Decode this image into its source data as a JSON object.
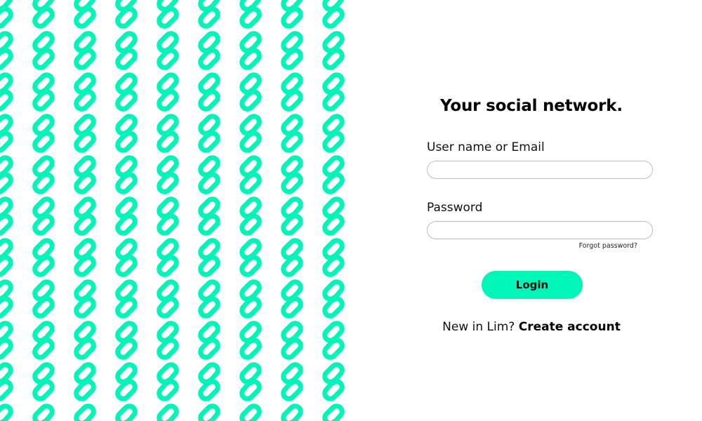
{
  "brand": {
    "accent_color": "#00f5b8",
    "pattern_icon": "infinity-knot-icon"
  },
  "login": {
    "tagline": "Your social network.",
    "username_label": "User name or Email",
    "username_value": "",
    "password_label": "Password",
    "password_value": "",
    "forgot_password": "Forgot password?",
    "login_button": "Login",
    "signup_prompt": "New in Lim?",
    "signup_link": "Create account"
  }
}
